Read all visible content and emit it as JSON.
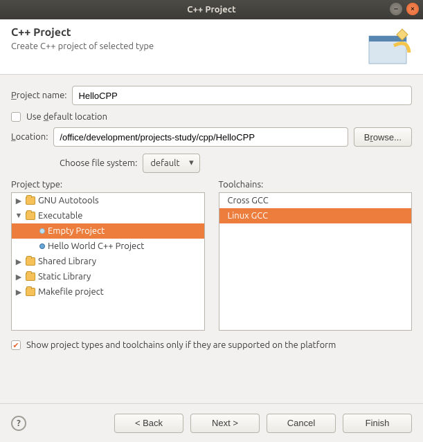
{
  "window": {
    "title": "C++ Project"
  },
  "header": {
    "title": "C++ Project",
    "subtitle": "Create C++ project of selected type"
  },
  "form": {
    "project_name_label_pre": "P",
    "project_name_label_post": "roject name:",
    "project_name_value": "HelloCPP",
    "use_default_pre": "Use ",
    "use_default_u": "d",
    "use_default_post": "efault location",
    "location_u": "L",
    "location_post": "ocation:",
    "location_value": "/office/development/projects-study/cpp/HelloCPP",
    "browse_pre": "B",
    "browse_u": "r",
    "browse_post": "owse...",
    "filesys_pre": "Choose f",
    "filesys_u": "i",
    "filesys_post": "le system:",
    "filesys_value": "default"
  },
  "project_type": {
    "label": "Project type:",
    "items": {
      "gnu": "GNU Autotools",
      "exec": "Executable",
      "empty": "Empty Project",
      "hello": "Hello World C++ Project",
      "shared": "Shared Library",
      "static": "Static Library",
      "make": "Makefile project"
    }
  },
  "toolchains": {
    "label": "Toolchains:",
    "cross": "Cross GCC",
    "linux": "Linux GCC"
  },
  "support_checkbox": "Show project types and toolchains only if they are supported on the platform",
  "buttons": {
    "back": "< Back",
    "next": "Next >",
    "cancel": "Cancel",
    "finish": "Finish"
  }
}
